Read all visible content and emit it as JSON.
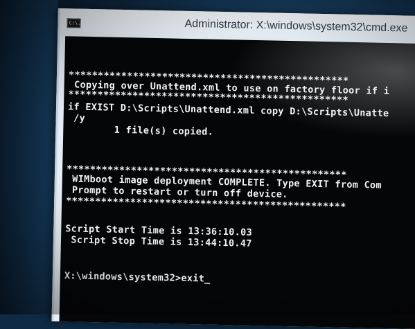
{
  "window": {
    "icon_text": "C:\\.",
    "title": "Administrator: X:\\windows\\system32\\cmd.exe"
  },
  "console": {
    "lines": [
      "************************************************",
      " Copying over Unattend.xml to use on factory floor if i",
      "************************************************",
      "if EXIST D:\\Scripts\\Unattend.xml copy D:\\Scripts\\Unatte",
      " /y",
      "        1 file(s) copied.",
      "",
      "",
      "************************************************",
      " WIMboot image deployment COMPLETE. Type EXIT from Com",
      " Prompt to restart or turn off device.",
      "************************************************",
      "",
      "",
      "Script Start Time is 13:36:10.03",
      " Script Stop Time is 13:44:10.47",
      "",
      "",
      "X:\\windows\\system32>exit_"
    ]
  }
}
